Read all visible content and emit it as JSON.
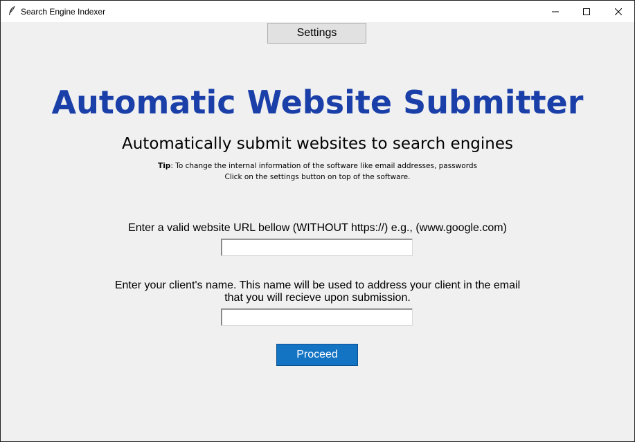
{
  "window": {
    "title": "Search Engine Indexer"
  },
  "toolbar": {
    "settings_label": "Settings"
  },
  "header": {
    "title": "Automatic Website Submitter",
    "subtitle": "Automatically submit websites to search engines",
    "tip_bold": "Tip",
    "tip_line1": ": To change the internal information of the software like email addresses, passwords",
    "tip_line2": "Click on the settings button on top of the software."
  },
  "form": {
    "url_label": "Enter a valid website URL bellow (WITHOUT https://) e.g., (www.google.com)",
    "url_value": "",
    "name_label_line1": "Enter your client's name. This name will be used to address your client in the email",
    "name_label_line2": "that you will recieve upon submission.",
    "name_value": "",
    "proceed_label": "Proceed"
  },
  "colors": {
    "accent": "#1a3fa8",
    "button": "#1474c4",
    "background": "#f0f0f0"
  },
  "icons": [
    "feather-icon",
    "minimize-icon",
    "maximize-icon",
    "close-icon"
  ]
}
